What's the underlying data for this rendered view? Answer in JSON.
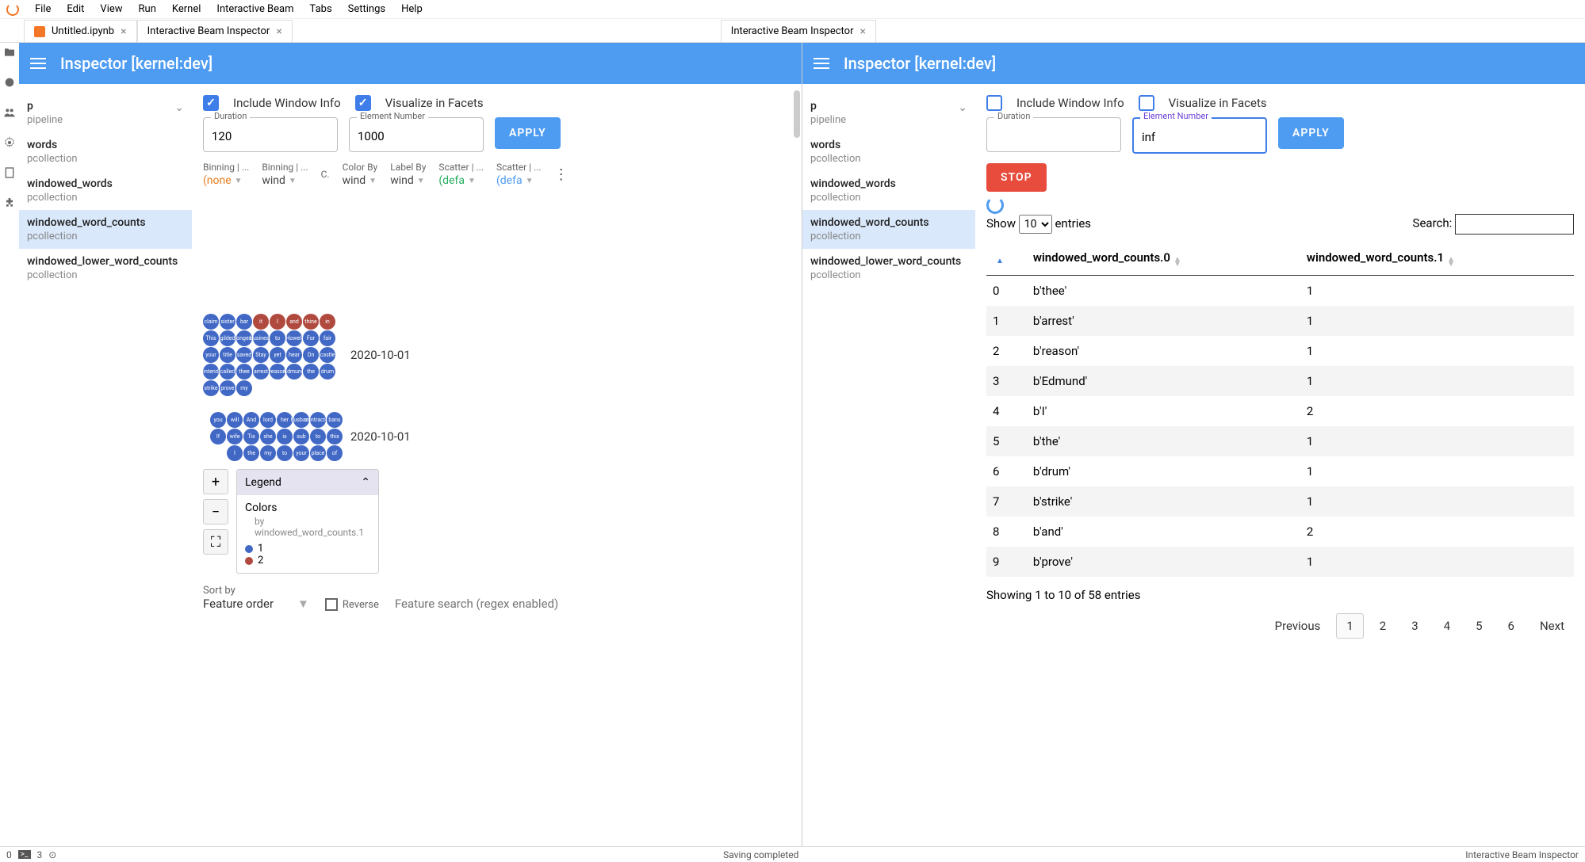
{
  "menubar": [
    "File",
    "Edit",
    "View",
    "Run",
    "Kernel",
    "Interactive Beam",
    "Tabs",
    "Settings",
    "Help"
  ],
  "tabs": [
    {
      "label": "Untitled.ipynb",
      "icon": "ipynb",
      "closable": true
    },
    {
      "label": "Interactive Beam Inspector",
      "closable": true
    },
    {
      "label": "Interactive Beam Inspector",
      "closable": true
    }
  ],
  "inspector_title": "Inspector [kernel:dev]",
  "sidebar": [
    {
      "name": "p",
      "type": "pipeline",
      "chevron": true
    },
    {
      "name": "words",
      "type": "pcollection"
    },
    {
      "name": "windowed_words",
      "type": "pcollection"
    },
    {
      "name": "windowed_word_counts",
      "type": "pcollection"
    },
    {
      "name": "windowed_lower_word_counts",
      "type": "pcollection"
    }
  ],
  "left": {
    "include_window": "Include Window Info",
    "visualize_facets": "Visualize in Facets",
    "duration_label": "Duration",
    "duration_value": "120",
    "element_label": "Element Number",
    "element_value": "1000",
    "apply": "APPLY",
    "facets_headers": [
      "Binning | ...",
      "Binning | ...",
      "C.",
      "Color By",
      "Label By",
      "Scatter | ...",
      "Scatter | ..."
    ],
    "facets_values": [
      "(none",
      "wind",
      "",
      "wind",
      "wind",
      "(defa",
      "(defa"
    ],
    "date1": "2020-10-01",
    "date2": "2020-10-01",
    "bubbles1": [
      "claim",
      "sister",
      "bar",
      "it",
      "I",
      "and",
      "thine",
      "in",
      "This",
      "gilded",
      "longest",
      "business",
      "to",
      "Howell",
      "For",
      "fair",
      "your",
      "title",
      "saved",
      "Stay",
      "yet",
      "hear",
      "On",
      "castle",
      "intend",
      "called",
      "thee",
      "arrest",
      "reason",
      "Edmund",
      "the",
      "drum",
      "strike",
      "prove",
      "my"
    ],
    "bubbles1_red": [
      3,
      4,
      5,
      6,
      7
    ],
    "bubbles2": [
      "you",
      "will",
      "And",
      "lord",
      "her",
      "husband",
      "contracted",
      "bans",
      "If",
      "wife",
      "Tis",
      "she",
      "is",
      "sub",
      "to",
      "this",
      "I",
      "the",
      "my",
      "to",
      "your",
      "place",
      "of"
    ],
    "legend_title": "Legend",
    "legend_colors": "Colors",
    "legend_by": "by windowed_word_counts.1",
    "legend_items": [
      {
        "color": "#4168c5",
        "label": "1"
      },
      {
        "color": "#b04a3f",
        "label": "2"
      }
    ],
    "sort_label": "Sort by",
    "sort_value": "Feature order",
    "reverse": "Reverse",
    "feature_search_placeholder": "Feature search (regex enabled)"
  },
  "right": {
    "include_window": "Include Window Info",
    "visualize_facets": "Visualize in Facets",
    "duration_label": "Duration",
    "element_label": "Element Number",
    "element_value": "inf",
    "apply": "APPLY",
    "stop": "STOP",
    "show": "Show",
    "show_count": "10",
    "entries": "entries",
    "search": "Search:",
    "cols": [
      "",
      "windowed_word_counts.0",
      "windowed_word_counts.1"
    ],
    "rows": [
      [
        "0",
        "b'thee'",
        "1"
      ],
      [
        "1",
        "b'arrest'",
        "1"
      ],
      [
        "2",
        "b'reason'",
        "1"
      ],
      [
        "3",
        "b'Edmund'",
        "1"
      ],
      [
        "4",
        "b'I'",
        "2"
      ],
      [
        "5",
        "b'the'",
        "1"
      ],
      [
        "6",
        "b'drum'",
        "1"
      ],
      [
        "7",
        "b'strike'",
        "1"
      ],
      [
        "8",
        "b'and'",
        "2"
      ],
      [
        "9",
        "b'prove'",
        "1"
      ]
    ],
    "info": "Showing 1 to 10 of 58 entries",
    "pager_prev": "Previous",
    "pager_next": "Next",
    "pager_pages": [
      "1",
      "2",
      "3",
      "4",
      "5",
      "6"
    ]
  },
  "statusbar": {
    "left_num": "0",
    "left_other": "3",
    "center": "Saving completed",
    "right": "Interactive Beam Inspector"
  }
}
